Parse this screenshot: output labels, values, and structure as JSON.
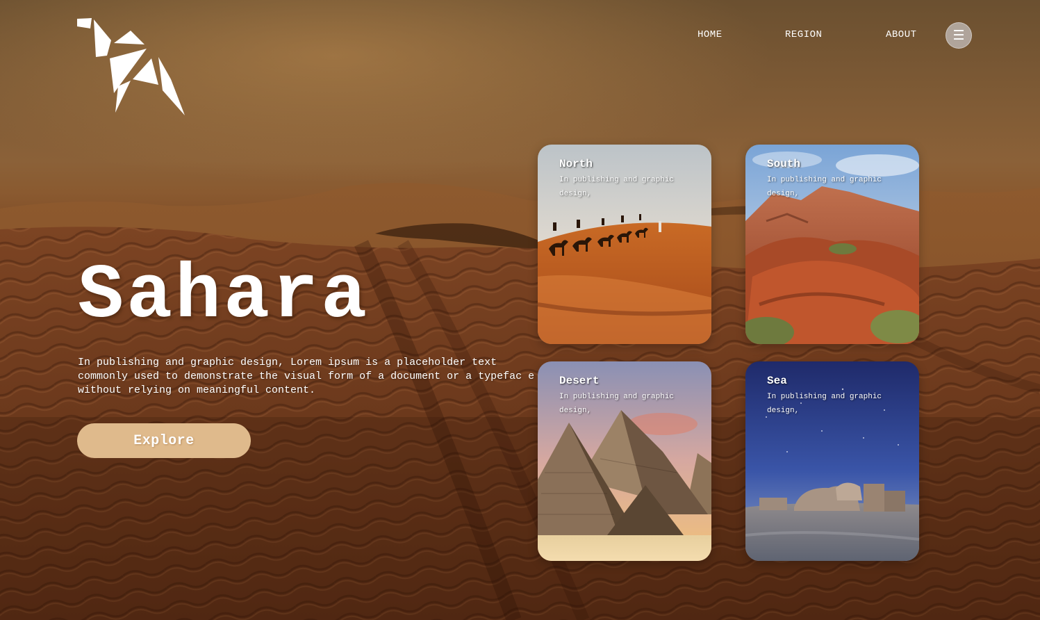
{
  "brand": {
    "logo_icon": "origami-camel-icon"
  },
  "nav": {
    "links": [
      {
        "label": "HOME"
      },
      {
        "label": "REGION"
      },
      {
        "label": "ABOUT"
      }
    ],
    "menu_icon": "hamburger-menu-icon",
    "menu_glyph": "☰"
  },
  "hero": {
    "title": "Sahara",
    "description": "In publishing and graphic design, Lorem ipsum is a placeholder text commonly used to demonstrate the visual form of a document or a typefac e without relying on meaningful content.",
    "button_label": "Explore"
  },
  "cards": [
    {
      "title": "North",
      "text": "In publishing and graphic design,",
      "image": "camel-caravan-dunes"
    },
    {
      "title": "South",
      "text": "In publishing and graphic design,",
      "image": "red-rock-canyon"
    },
    {
      "title": "Desert",
      "text": "In publishing and graphic design,",
      "image": "giza-pyramids"
    },
    {
      "title": "Sea",
      "text": "In publishing and graphic design,",
      "image": "desert-ruins-night-sky"
    }
  ],
  "colors": {
    "accent_button": "#dfba8c",
    "background_sand": "#6e3a1b",
    "menu_button": "#c8c4c4"
  }
}
